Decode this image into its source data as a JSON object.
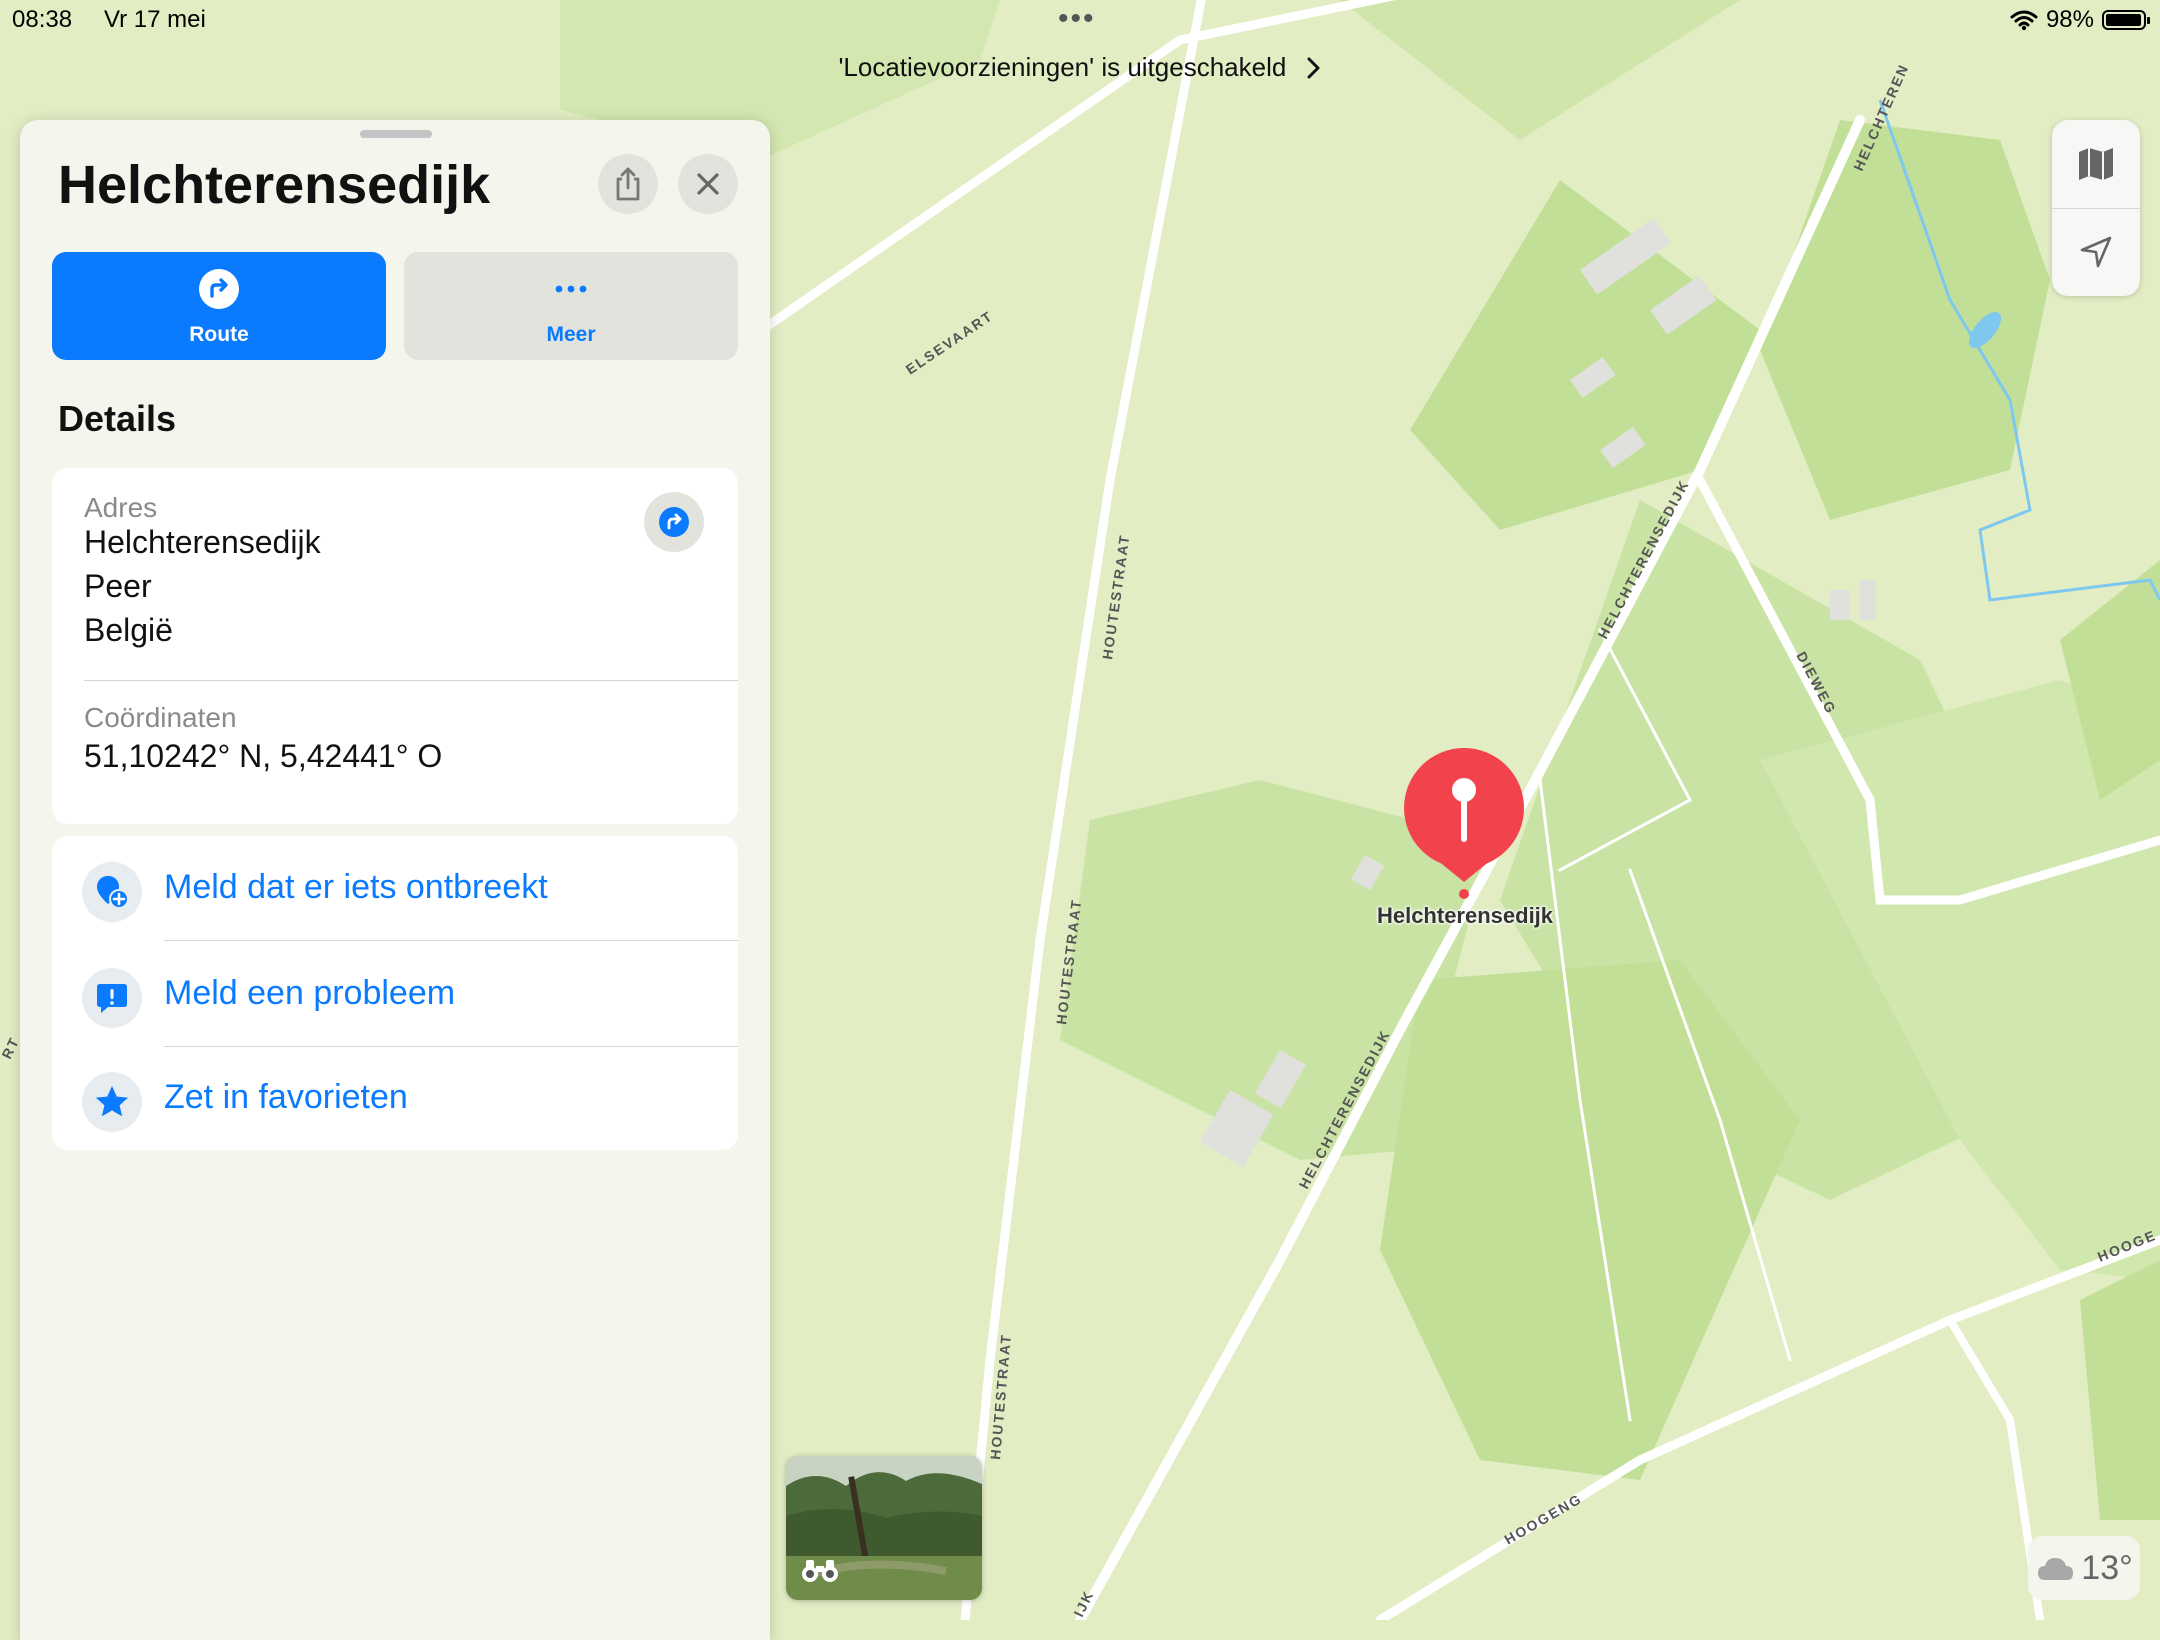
{
  "status_bar": {
    "time": "08:38",
    "date": "Vr 17 mei",
    "battery": "98%",
    "battery_level": 0.98
  },
  "banner": {
    "text": "'Locatievoorzieningen' is uitgeschakeld"
  },
  "place": {
    "title": "Helchterensedijk"
  },
  "actions": {
    "route_label": "Route",
    "more_label": "Meer"
  },
  "details": {
    "heading": "Details",
    "address_label": "Adres",
    "address_lines": [
      "Helchterensedijk",
      "Peer",
      "België"
    ],
    "coordinates_label": "Coördinaten",
    "coordinates": "51,10242° N, 5,42441° O"
  },
  "links": [
    {
      "label": "Meld dat er iets ontbreekt",
      "icon": "add-location-icon"
    },
    {
      "label": "Meld een probleem",
      "icon": "report-problem-icon"
    },
    {
      "label": "Zet in favorieten",
      "icon": "star-icon"
    }
  ],
  "map": {
    "pin_label": "Helchterensedijk",
    "pin_color": "#f2434d",
    "street_labels": {
      "elsevaart": "ELSEVAART",
      "houtestraat": "HOUTESTRAAT",
      "helchterensedijk": "HELCHTERENSEDIJK",
      "dieweg": "DIEWEG",
      "hoogeng": "HOOGENG",
      "hooge": "HOOGE",
      "helchteren_top": "HELCHTEREN",
      "ijk": "IJK",
      "rt": "RT"
    }
  },
  "weather": {
    "temperature": "13°",
    "icon": "cloud-icon"
  },
  "colors": {
    "accent": "#0a7aff",
    "map_base": "#e3edc4",
    "map_field": "#c9e3a4"
  }
}
